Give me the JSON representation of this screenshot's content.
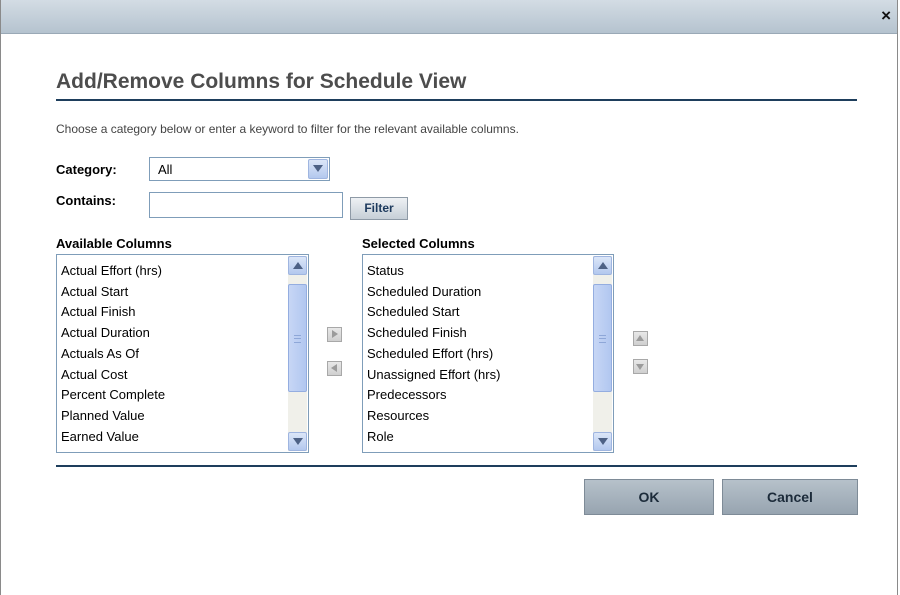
{
  "dialog": {
    "close_glyph": "×",
    "title": "Add/Remove Columns for Schedule View",
    "description": "Choose a category below or enter a keyword to filter for the relevant available columns."
  },
  "category": {
    "label": "Category:",
    "value": "All"
  },
  "contains": {
    "label": "Contains:",
    "value": "",
    "placeholder": ""
  },
  "filter_button": "Filter",
  "available": {
    "label": "Available Columns",
    "items": [
      "Actual Effort (hrs)",
      "Actual Start",
      "Actual Finish",
      "Actual Duration",
      "Actuals As Of",
      "Actual Cost",
      "Percent Complete",
      "Planned Value",
      "Earned Value"
    ]
  },
  "selected": {
    "label": "Selected Columns",
    "items": [
      "Status",
      "Scheduled Duration",
      "Scheduled Start",
      "Scheduled Finish",
      "Scheduled Effort (hrs)",
      "Unassigned Effort (hrs)",
      "Predecessors",
      "Resources",
      "Role"
    ]
  },
  "buttons": {
    "ok": "OK",
    "cancel": "Cancel"
  },
  "icons": {
    "close": "close-icon",
    "move_right": "arrow-right-icon",
    "move_left": "arrow-left-icon",
    "move_up": "arrow-up-icon",
    "move_down": "arrow-down-icon"
  },
  "colors": {
    "title_text": "#4d4d4d",
    "rule": "#1e3e5c",
    "titlebar": "#c5d0da",
    "action_button": "#a9b5c0"
  }
}
